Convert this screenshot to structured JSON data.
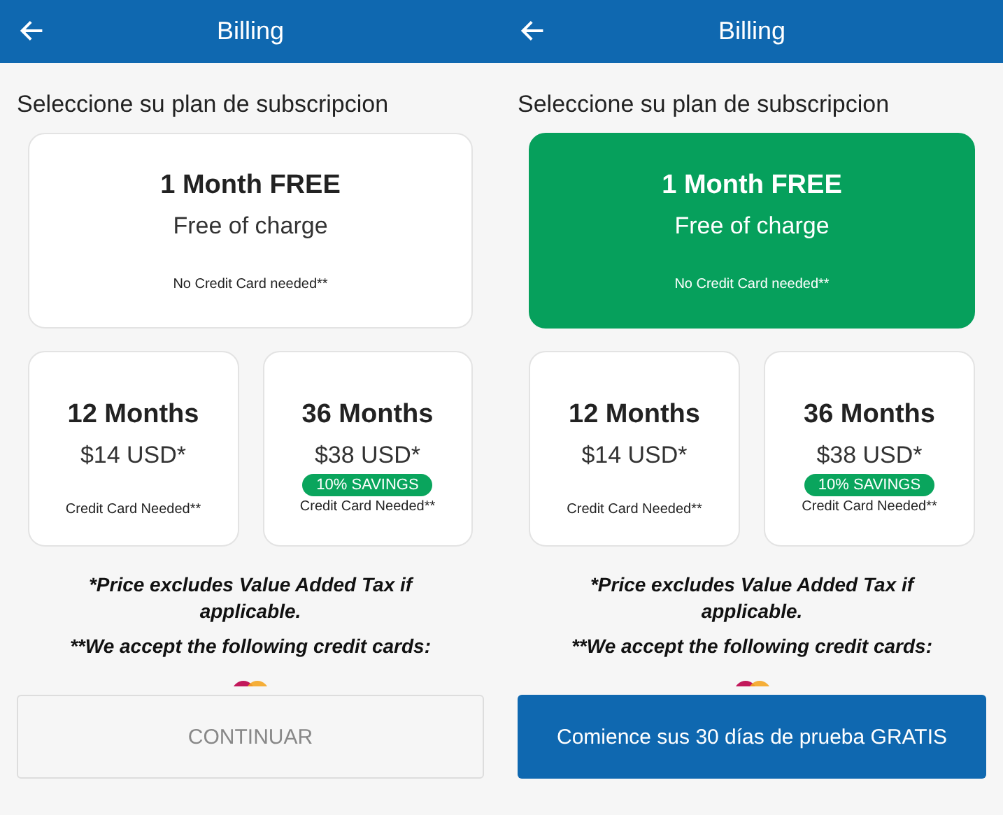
{
  "screens": [
    {
      "title": "Billing",
      "heading": "Seleccione su plan de subscripcion",
      "free_plan": {
        "name": "1 Month FREE",
        "subtitle": "Free of charge",
        "note": "No Credit Card needed**",
        "selected": false
      },
      "plans": [
        {
          "name": "12 Months",
          "price": "$14 USD*",
          "note": "Credit Card Needed**"
        },
        {
          "name": "36 Months",
          "price": "$38 USD*",
          "badge": "10% SAVINGS",
          "note": "Credit Card Needed**"
        }
      ],
      "notes": [
        "*Price excludes Value Added Tax if applicable.",
        "**We accept the following credit cards:"
      ],
      "button": {
        "label": "CONTINUAR",
        "disabled": true
      }
    },
    {
      "title": "Billing",
      "heading": "Seleccione su plan de subscripcion",
      "free_plan": {
        "name": "1 Month FREE",
        "subtitle": "Free of charge",
        "note": "No Credit Card needed**",
        "selected": true
      },
      "plans": [
        {
          "name": "12 Months",
          "price": "$14 USD*",
          "note": "Credit Card Needed**"
        },
        {
          "name": "36 Months",
          "price": "$38 USD*",
          "badge": "10% SAVINGS",
          "note": "Credit Card Needed**"
        }
      ],
      "notes": [
        "*Price excludes Value Added Tax if applicable.",
        "**We accept the following credit cards:"
      ],
      "button": {
        "label": "Comience sus 30 días de prueba GRATIS",
        "disabled": false
      }
    }
  ]
}
